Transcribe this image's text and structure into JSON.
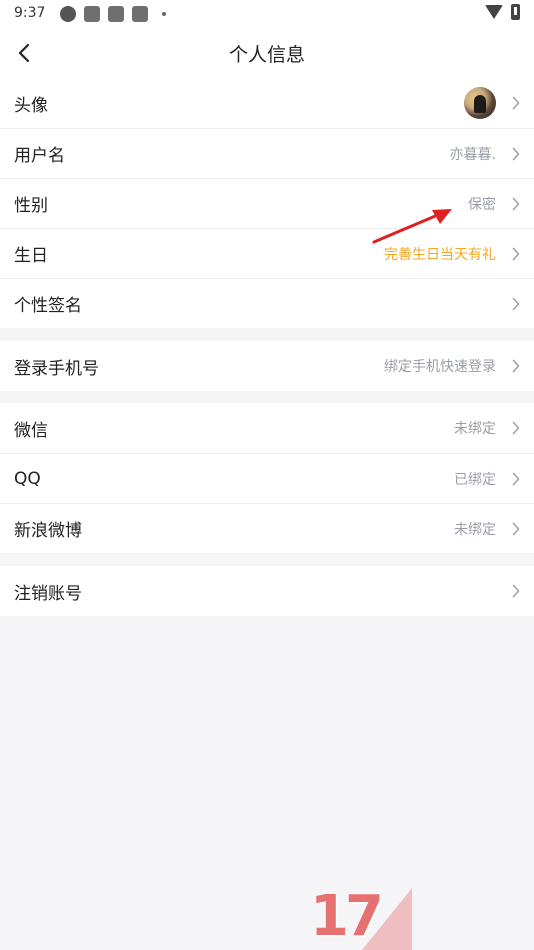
{
  "status_bar": {
    "time": "9:37",
    "icons": [
      "app-icon",
      "notification-icon",
      "notification-icon",
      "notification-icon"
    ]
  },
  "header": {
    "title": "个人信息"
  },
  "groups": [
    {
      "rows": [
        {
          "label": "头像",
          "value": "",
          "kind": "avatar"
        },
        {
          "label": "用户名",
          "value": "亦暮暮."
        },
        {
          "label": "性别",
          "value": "保密"
        },
        {
          "label": "生日",
          "value": "完善生日当天有礼",
          "accent": true
        },
        {
          "label": "个性签名",
          "value": ""
        }
      ]
    },
    {
      "rows": [
        {
          "label": "登录手机号",
          "value": "绑定手机快速登录"
        }
      ]
    },
    {
      "rows": [
        {
          "label": "微信",
          "value": "未绑定"
        },
        {
          "label": "QQ",
          "value": "已绑定"
        },
        {
          "label": "新浪微博",
          "value": "未绑定"
        }
      ]
    },
    {
      "rows": [
        {
          "label": "注销账号",
          "value": ""
        }
      ]
    }
  ],
  "watermark": {
    "text": "17"
  },
  "colors": {
    "accent": "#f5a623",
    "value_gray": "#9a9ea6",
    "annotation_arrow": "#e02020",
    "background": "#f5f5f7"
  }
}
